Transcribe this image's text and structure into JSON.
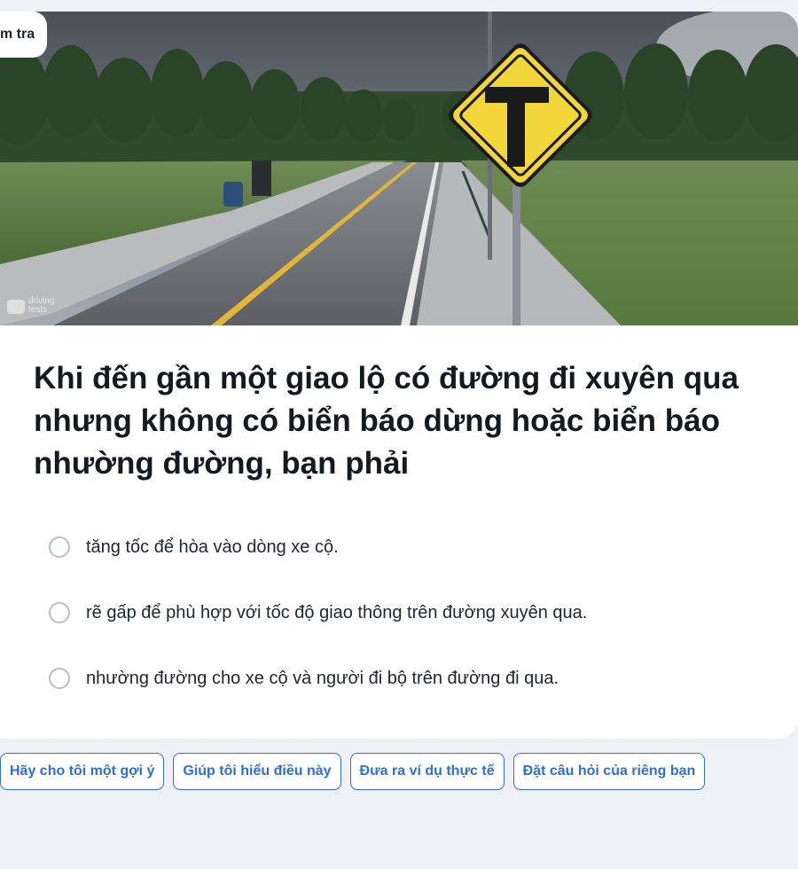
{
  "badge": {
    "label": "m tra"
  },
  "hero": {
    "watermark": "driving tests",
    "sign_icon": "t-intersection-sign"
  },
  "question": {
    "text": "Khi đến gần một giao lộ có đường đi xuyên qua nhưng không có biển báo dừng hoặc biển báo nhường đường, bạn phải"
  },
  "options": [
    {
      "label": "tăng tốc để hòa vào dòng xe cộ."
    },
    {
      "label": "rẽ gấp để phù hợp với tốc độ giao thông trên đường xuyên qua."
    },
    {
      "label": "nhường đường cho xe cộ và người đi bộ trên đường đi qua."
    }
  ],
  "chips": [
    {
      "label": "Hãy cho tôi một gợi ý"
    },
    {
      "label": "Giúp tôi hiểu điều này"
    },
    {
      "label": "Đưa ra ví dụ thực tế"
    },
    {
      "label": "Đặt câu hỏi của riêng bạn"
    }
  ],
  "colors": {
    "accent": "#2e6fd8",
    "page_bg": "#eff1f6",
    "sign_yellow": "#f2d63a"
  }
}
